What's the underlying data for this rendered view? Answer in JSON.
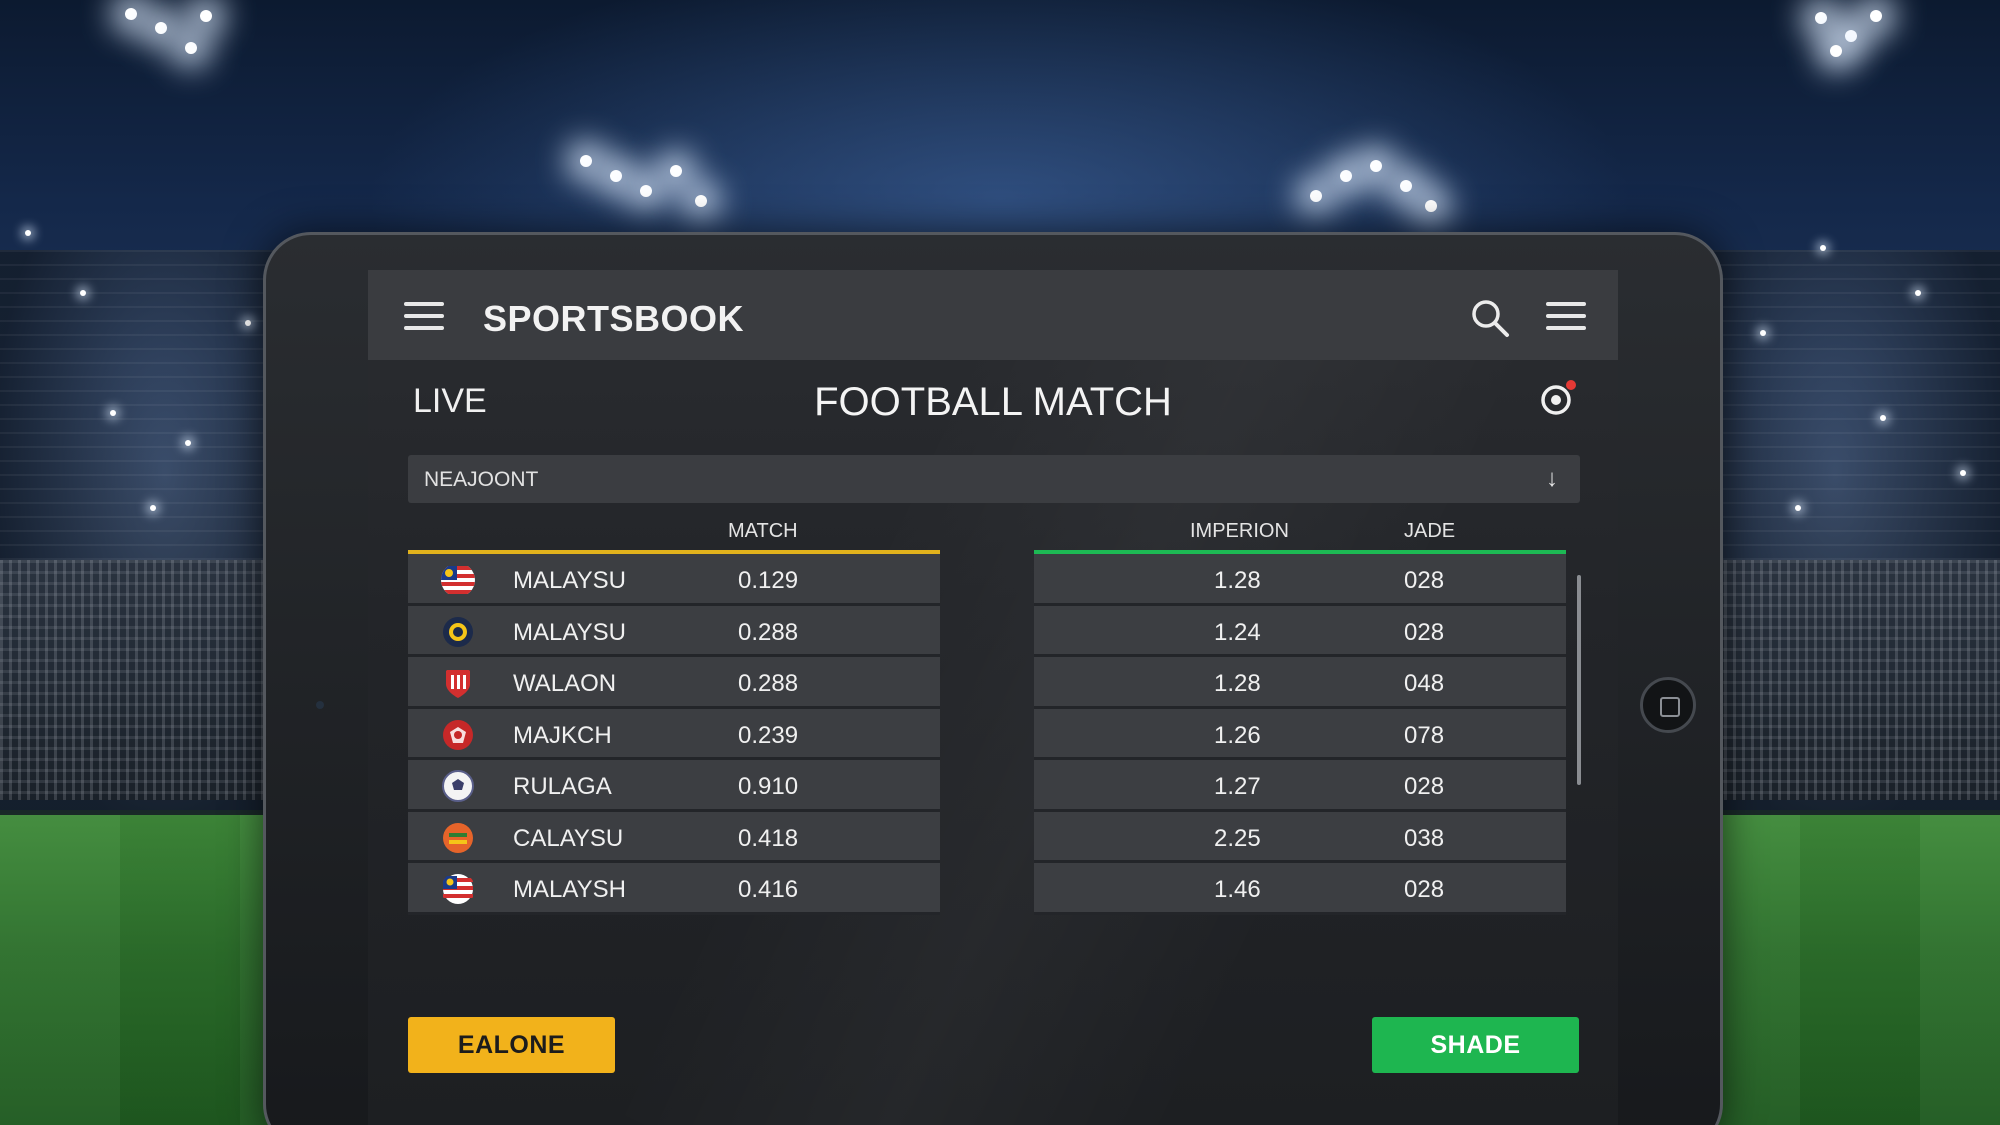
{
  "app": {
    "title": "SPORTSBOOK"
  },
  "header": {
    "live_label": "LIVE",
    "match_title": "FOOTBALL MATCH"
  },
  "filter": {
    "value": "NEAJOONT",
    "caret": "↓"
  },
  "columns": {
    "match": "MATCH",
    "imperion": "IMPERION",
    "jade": "JADE"
  },
  "rows": [
    {
      "team": "MALAYSU",
      "match": "0.129",
      "imperion": "1.28",
      "jade": "028",
      "icon": "malaysia-flag-icon"
    },
    {
      "team": "MALAYSU",
      "match": "0.288",
      "imperion": "1.24",
      "jade": "028",
      "icon": "team-crest-icon"
    },
    {
      "team": "WALAON",
      "match": "0.288",
      "imperion": "1.28",
      "jade": "048",
      "icon": "shield-crest-icon"
    },
    {
      "team": "MAJKCH",
      "match": "0.239",
      "imperion": "1.26",
      "jade": "078",
      "icon": "red-crest-icon"
    },
    {
      "team": "RULAGA",
      "match": "0.910",
      "imperion": "1.27",
      "jade": "028",
      "icon": "soccer-ball-icon"
    },
    {
      "team": "CALAYSU",
      "match": "0.418",
      "imperion": "2.25",
      "jade": "038",
      "icon": "orange-crest-icon"
    },
    {
      "team": "MALAYSH",
      "match": "0.416",
      "imperion": "1.46",
      "jade": "028",
      "icon": "malaysia-flag-icon"
    }
  ],
  "buttons": {
    "left_label": "EALONE",
    "right_label": "SHADE"
  },
  "colors": {
    "accent_yellow": "#f2b21b",
    "accent_green": "#1eb650",
    "record_dot": "#e53935"
  }
}
